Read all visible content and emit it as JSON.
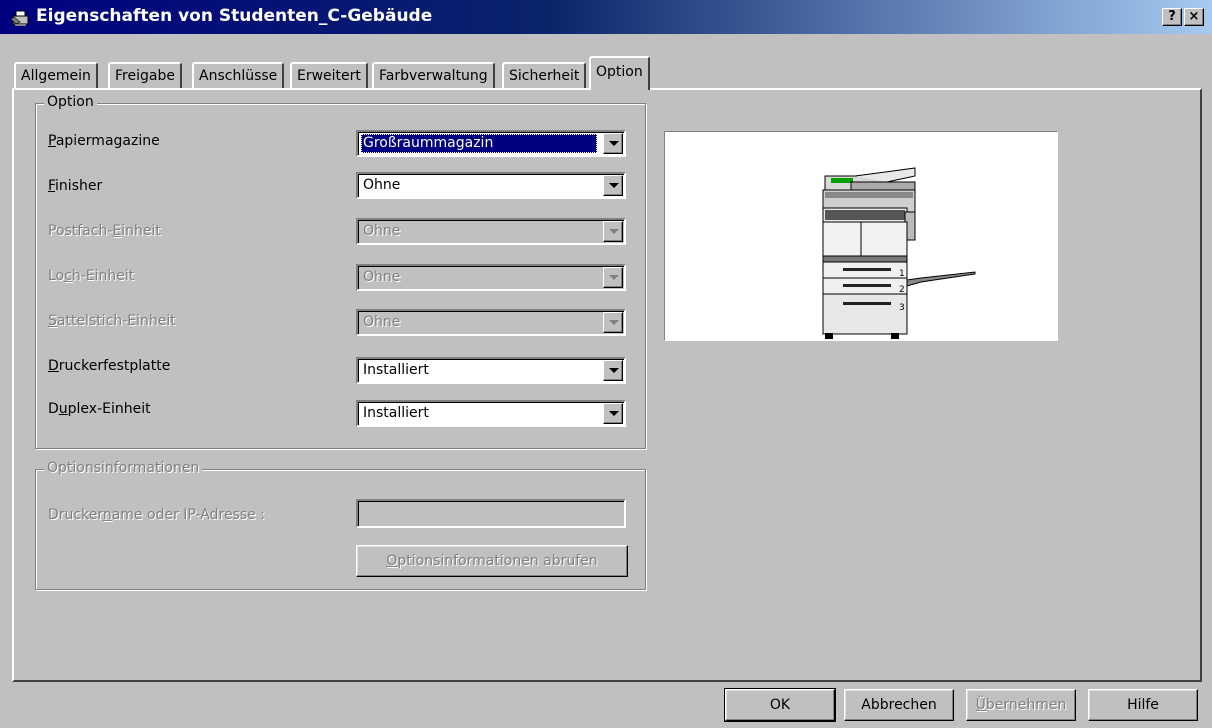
{
  "window": {
    "title": "Eigenschaften von Studenten_C-Gebäude",
    "help_button": "?",
    "close_button": "×"
  },
  "tabs": [
    {
      "label": "Allgemein",
      "active": false
    },
    {
      "label": "Freigabe",
      "active": false
    },
    {
      "label": "Anschlüsse",
      "active": false
    },
    {
      "label": "Erweitert",
      "active": false
    },
    {
      "label": "Farbverwaltung",
      "active": false
    },
    {
      "label": "Sicherheit",
      "active": false
    },
    {
      "label": "Option",
      "active": true
    }
  ],
  "option_group": {
    "legend": "Option",
    "rows": [
      {
        "label_first": "P",
        "label_rest": "apiermagazine",
        "value": "Großraummagazin",
        "enabled": true
      },
      {
        "label_first": "F",
        "label_rest": "inisher",
        "value": "Ohne",
        "enabled": true
      },
      {
        "label_pre": "Postfach-",
        "label_first": "E",
        "label_rest": "inheit",
        "value": "Ohne",
        "enabled": false
      },
      {
        "label_pre": "Lo",
        "label_first": "c",
        "label_rest": "h-Einheit",
        "value": "Ohne",
        "enabled": false
      },
      {
        "label_first": "S",
        "label_rest": "attelstich-Einheit",
        "value": "Ohne",
        "enabled": false
      },
      {
        "label_first": "D",
        "label_rest": "ruckerfestplatte",
        "value": "Installiert",
        "enabled": true
      },
      {
        "label_pre": "D",
        "label_first": "u",
        "label_rest": "plex-Einheit",
        "value": "Installiert",
        "enabled": true
      }
    ]
  },
  "info_group": {
    "legend": "Optionsinformationen",
    "field_label_pre": "Drucker",
    "field_label_first": "n",
    "field_label_rest": "ame oder IP-Adresse :",
    "field_value": "",
    "fetch_first": "O",
    "fetch_rest": "ptionsinformationen abrufen"
  },
  "preview": {
    "icon": "printer-copier-icon",
    "tray_numbers": [
      "1",
      "2",
      "3"
    ]
  },
  "buttons": {
    "ok": "OK",
    "cancel": "Abbrechen",
    "apply_first": "Ü",
    "apply_rest": "bernehmen",
    "help": "Hilfe"
  }
}
